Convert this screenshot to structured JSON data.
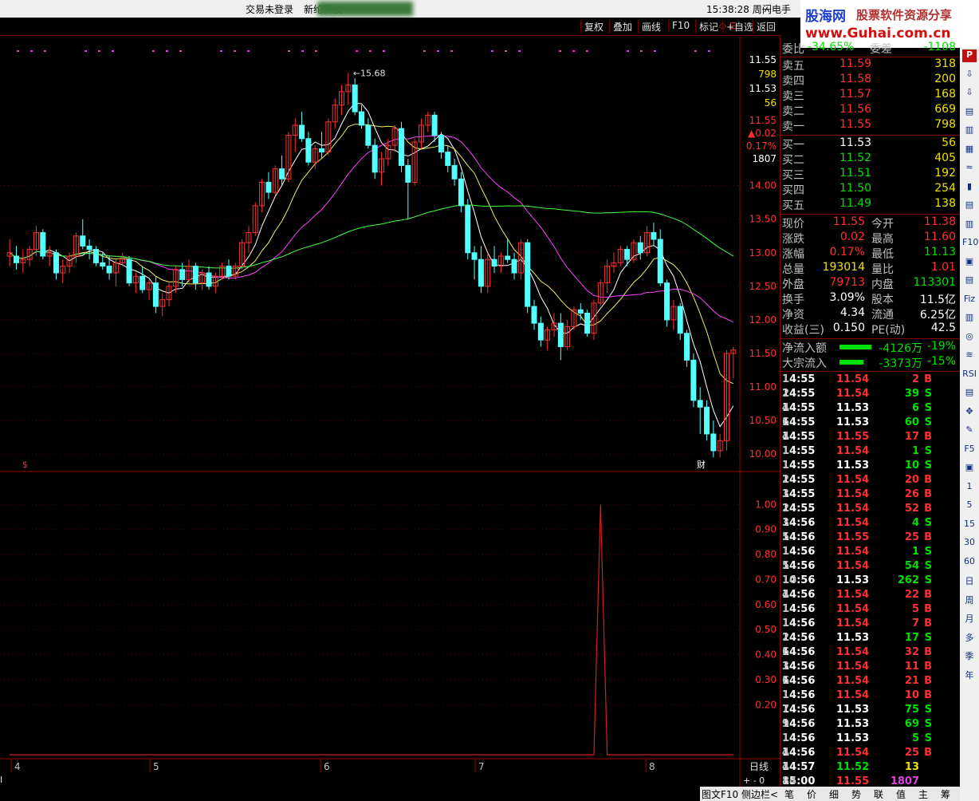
{
  "titlebar": {
    "login_status": "交易未登录",
    "stock_name": "新纶科技",
    "clock": "15:38:28 周一",
    "flash": "闪电手"
  },
  "logo": {
    "brand": "股海网",
    "slogan": "股票软件资源分享",
    "url": "www.Guhai.com.cn"
  },
  "toolbar": {
    "buttons": [
      "复权",
      "叠加",
      "画线",
      "F10",
      "标记",
      "+自选",
      "返回"
    ],
    "corner_icons": "◇ ⊟"
  },
  "price_axis": {
    "labels": [
      "14.00",
      "13.50",
      "13.00",
      "12.50",
      "12.00",
      "11.50",
      "11.00",
      "10.50",
      "10.00"
    ],
    "readout": {
      "price1": "11.55",
      "vol1": "798",
      "price2": "11.53",
      "vol2": "56",
      "price3": "11.55",
      "chg": "▲0.02",
      "pct": "0.17%",
      "vol3": "1807"
    }
  },
  "peak_label": "15.68",
  "chart_markers": {
    "s_marker": "$",
    "cai_marker": "财"
  },
  "indicator_axis": {
    "labels": [
      "1.00",
      "0.90",
      "0.80",
      "0.70",
      "0.60",
      "0.50",
      "0.40",
      "0.30",
      "0.20"
    ]
  },
  "x_axis": {
    "labels": [
      "4",
      "5",
      "6",
      "7",
      "8"
    ],
    "period": "日线",
    "left_glyph": "I",
    "zoom": "+ - 0"
  },
  "chart_data": {
    "type": "candlestick",
    "candles": [
      [
        12.95,
        13.2,
        12.8,
        13.0
      ],
      [
        12.95,
        13.1,
        12.75,
        12.85
      ],
      [
        12.85,
        13.05,
        12.7,
        12.9
      ],
      [
        12.9,
        13.1,
        12.8,
        13.05
      ],
      [
        13.05,
        13.4,
        12.95,
        13.3
      ],
      [
        13.3,
        13.35,
        12.9,
        12.95
      ],
      [
        12.95,
        13.1,
        12.8,
        13.0
      ],
      [
        13.0,
        13.05,
        12.6,
        12.7
      ],
      [
        12.7,
        12.9,
        12.55,
        12.8
      ],
      [
        12.8,
        13.0,
        12.7,
        12.95
      ],
      [
        12.95,
        13.3,
        12.85,
        13.25
      ],
      [
        13.25,
        13.5,
        13.05,
        13.1
      ],
      [
        13.1,
        13.2,
        12.9,
        13.05
      ],
      [
        13.05,
        13.1,
        12.8,
        12.85
      ],
      [
        12.85,
        13.0,
        12.75,
        12.8
      ],
      [
        12.8,
        12.95,
        12.6,
        12.7
      ],
      [
        12.7,
        12.9,
        12.5,
        12.85
      ],
      [
        12.85,
        13.0,
        12.8,
        12.9
      ],
      [
        12.9,
        12.95,
        12.5,
        12.55
      ],
      [
        12.55,
        12.7,
        12.4,
        12.65
      ],
      [
        12.65,
        12.8,
        12.4,
        12.45
      ],
      [
        12.45,
        12.6,
        12.3,
        12.55
      ],
      [
        12.55,
        12.65,
        12.1,
        12.2
      ],
      [
        12.2,
        12.4,
        12.05,
        12.3
      ],
      [
        12.3,
        12.55,
        12.2,
        12.5
      ],
      [
        12.5,
        12.8,
        12.4,
        12.75
      ],
      [
        12.75,
        12.85,
        12.5,
        12.6
      ],
      [
        12.6,
        12.9,
        12.55,
        12.8
      ],
      [
        12.8,
        12.85,
        12.45,
        12.55
      ],
      [
        12.55,
        12.75,
        12.45,
        12.7
      ],
      [
        12.7,
        12.8,
        12.45,
        12.5
      ],
      [
        12.5,
        12.7,
        12.4,
        12.65
      ],
      [
        12.65,
        12.85,
        12.6,
        12.8
      ],
      [
        12.8,
        12.9,
        12.6,
        12.65
      ],
      [
        12.65,
        12.85,
        12.6,
        12.8
      ],
      [
        12.8,
        13.2,
        12.75,
        13.15
      ],
      [
        13.15,
        13.4,
        13.0,
        13.3
      ],
      [
        13.3,
        13.75,
        13.25,
        13.7
      ],
      [
        13.7,
        14.1,
        13.6,
        14.05
      ],
      [
        14.05,
        14.2,
        13.8,
        13.9
      ],
      [
        13.9,
        14.3,
        13.85,
        14.25
      ],
      [
        14.25,
        14.45,
        14.0,
        14.1
      ],
      [
        14.1,
        14.8,
        14.05,
        14.75
      ],
      [
        14.75,
        15.0,
        14.5,
        14.9
      ],
      [
        14.9,
        15.1,
        14.65,
        14.7
      ],
      [
        14.7,
        14.8,
        14.3,
        14.35
      ],
      [
        14.35,
        14.6,
        14.25,
        14.55
      ],
      [
        14.55,
        14.8,
        14.4,
        14.5
      ],
      [
        14.5,
        15.0,
        14.45,
        14.95
      ],
      [
        14.95,
        15.3,
        14.85,
        15.2
      ],
      [
        15.2,
        15.5,
        15.05,
        15.4
      ],
      [
        15.4,
        15.68,
        15.2,
        15.5
      ],
      [
        15.5,
        15.6,
        15.05,
        15.1
      ],
      [
        15.1,
        15.2,
        14.85,
        14.9
      ],
      [
        14.9,
        15.0,
        14.55,
        14.6
      ],
      [
        14.6,
        14.7,
        14.1,
        14.2
      ],
      [
        14.2,
        14.5,
        14.0,
        14.4
      ],
      [
        14.4,
        14.7,
        14.3,
        14.6
      ],
      [
        14.6,
        14.9,
        14.5,
        14.85
      ],
      [
        14.85,
        14.95,
        14.2,
        14.3
      ],
      [
        14.3,
        14.4,
        13.5,
        14.05
      ],
      [
        14.05,
        14.7,
        14.0,
        14.65
      ],
      [
        14.65,
        15.0,
        14.55,
        14.9
      ],
      [
        14.9,
        15.1,
        14.8,
        15.05
      ],
      [
        15.05,
        15.1,
        14.65,
        14.75
      ],
      [
        14.75,
        14.8,
        14.4,
        14.5
      ],
      [
        14.5,
        14.6,
        14.2,
        14.3
      ],
      [
        14.3,
        14.4,
        14.0,
        14.1
      ],
      [
        14.1,
        14.2,
        13.6,
        13.7
      ],
      [
        13.7,
        13.8,
        12.9,
        13.0
      ],
      [
        13.0,
        13.1,
        12.6,
        12.9
      ],
      [
        12.9,
        13.1,
        12.4,
        12.5
      ],
      [
        12.5,
        13.0,
        12.4,
        12.9
      ],
      [
        12.9,
        13.1,
        12.7,
        12.8
      ],
      [
        12.8,
        13.0,
        12.7,
        12.95
      ],
      [
        12.95,
        13.2,
        12.85,
        12.9
      ],
      [
        12.9,
        13.0,
        12.6,
        12.7
      ],
      [
        12.7,
        13.2,
        12.6,
        13.15
      ],
      [
        13.15,
        13.2,
        12.1,
        12.2
      ],
      [
        12.2,
        12.3,
        11.85,
        11.95
      ],
      [
        11.95,
        12.05,
        11.6,
        11.7
      ],
      [
        11.7,
        11.9,
        11.55,
        11.85
      ],
      [
        11.85,
        12.1,
        11.75,
        11.95
      ],
      [
        11.95,
        12.1,
        11.4,
        11.6
      ],
      [
        11.6,
        12.0,
        11.55,
        11.9
      ],
      [
        11.9,
        12.2,
        11.85,
        12.15
      ],
      [
        12.15,
        12.25,
        12.0,
        12.1
      ],
      [
        12.1,
        12.15,
        11.75,
        11.8
      ],
      [
        11.8,
        12.3,
        11.7,
        12.25
      ],
      [
        12.25,
        12.6,
        12.2,
        12.55
      ],
      [
        12.55,
        12.9,
        12.4,
        12.8
      ],
      [
        12.8,
        13.0,
        12.7,
        12.85
      ],
      [
        12.85,
        13.1,
        12.8,
        13.05
      ],
      [
        13.05,
        13.1,
        12.8,
        12.9
      ],
      [
        12.9,
        13.2,
        12.85,
        13.15
      ],
      [
        13.15,
        13.25,
        12.9,
        13.0
      ],
      [
        13.0,
        13.4,
        12.95,
        13.3
      ],
      [
        13.3,
        13.45,
        13.1,
        13.2
      ],
      [
        13.2,
        13.35,
        12.5,
        12.55
      ],
      [
        12.55,
        12.6,
        11.9,
        12.0
      ],
      [
        12.0,
        12.3,
        11.85,
        12.2
      ],
      [
        12.2,
        12.25,
        11.7,
        11.8
      ],
      [
        11.8,
        11.85,
        11.3,
        11.4
      ],
      [
        11.4,
        11.5,
        10.7,
        10.8
      ],
      [
        10.8,
        11.0,
        10.3,
        10.7
      ],
      [
        10.7,
        10.8,
        10.2,
        10.3
      ],
      [
        10.3,
        10.5,
        9.95,
        10.05
      ],
      [
        10.05,
        10.3,
        9.95,
        10.2
      ],
      [
        10.2,
        11.55,
        10.05,
        11.5
      ],
      [
        11.5,
        11.6,
        11.13,
        11.55
      ]
    ],
    "ylim": [
      9.8,
      16.1
    ],
    "indicator": {
      "ylim": [
        0,
        1.1
      ],
      "spikes_at": [
        89,
        115
      ]
    }
  },
  "quote": {
    "weibi": {
      "label": "委比",
      "value": "-34.65%",
      "label2": "委差",
      "value2": "-1108"
    },
    "sells": [
      {
        "label": "卖五",
        "price": "11.59",
        "vol": "318"
      },
      {
        "label": "卖四",
        "price": "11.58",
        "vol": "200"
      },
      {
        "label": "卖三",
        "price": "11.57",
        "vol": "168"
      },
      {
        "label": "卖二",
        "price": "11.56",
        "vol": "669"
      },
      {
        "label": "卖一",
        "price": "11.55",
        "vol": "798"
      }
    ],
    "buys": [
      {
        "label": "买一",
        "price": "11.53",
        "vol": "56"
      },
      {
        "label": "买二",
        "price": "11.52",
        "vol": "405"
      },
      {
        "label": "买三",
        "price": "11.51",
        "vol": "192"
      },
      {
        "label": "买四",
        "price": "11.50",
        "vol": "254"
      },
      {
        "label": "买五",
        "price": "11.49",
        "vol": "138"
      }
    ],
    "stats": [
      {
        "l1": "现价",
        "v1": "11.55",
        "l2": "今开",
        "v2": "11.38",
        "c1": "red",
        "c2": "red"
      },
      {
        "l1": "涨跌",
        "v1": "0.02",
        "l2": "最高",
        "v2": "11.60",
        "c1": "red",
        "c2": "red"
      },
      {
        "l1": "涨幅",
        "v1": "0.17%",
        "l2": "最低",
        "v2": "11.13",
        "c1": "red",
        "c2": "grn"
      },
      {
        "l1": "总量",
        "v1": "193014",
        "l2": "量比",
        "v2": "1.01",
        "c1": "yel",
        "c2": "red"
      },
      {
        "l1": "外盘",
        "v1": "79713",
        "l2": "内盘",
        "v2": "113301",
        "c1": "red",
        "c2": "grn"
      },
      {
        "l1": "换手",
        "v1": "3.09%",
        "l2": "股本",
        "v2": "11.5亿",
        "c1": "wht",
        "c2": "wht"
      },
      {
        "l1": "净资",
        "v1": "4.34",
        "l2": "流通",
        "v2": "6.25亿",
        "c1": "wht",
        "c2": "wht"
      },
      {
        "l1": "收益(三)",
        "v1": "0.150",
        "l2": "PE(动)",
        "v2": "42.5",
        "c1": "wht",
        "c2": "wht"
      }
    ],
    "flows": [
      {
        "label": "净流入额",
        "value": "-4126万",
        "pct": "-19%",
        "bar": 0.8
      },
      {
        "label": "大宗流入",
        "value": "-3373万",
        "pct": "-15%",
        "bar": 0.6
      }
    ]
  },
  "ticks": [
    [
      "14:55",
      "11.54",
      "2",
      "B",
      "1"
    ],
    [
      "14:55",
      "11.54",
      "39",
      "S",
      "2"
    ],
    [
      "14:55",
      "11.53",
      "6",
      "S",
      "4"
    ],
    [
      "14:55",
      "11.53",
      "60",
      "S",
      "6"
    ],
    [
      "14:55",
      "11.55",
      "17",
      "B",
      "4"
    ],
    [
      "14:55",
      "11.54",
      "1",
      "S",
      "1"
    ],
    [
      "14:55",
      "11.53",
      "10",
      "S",
      "1"
    ],
    [
      "14:55",
      "11.54",
      "20",
      "B",
      "2"
    ],
    [
      "14:55",
      "11.54",
      "26",
      "B",
      "3"
    ],
    [
      "14:55",
      "11.54",
      "52",
      "B",
      "2"
    ],
    [
      "14:56",
      "11.54",
      "4",
      "S",
      "3"
    ],
    [
      "14:56",
      "11.55",
      "25",
      "B",
      "5"
    ],
    [
      "14:56",
      "11.54",
      "1",
      "S",
      "1"
    ],
    [
      "14:56",
      "11.54",
      "54",
      "S",
      "5"
    ],
    [
      "14:56",
      "11.53",
      "262",
      "S",
      "10"
    ],
    [
      "14:56",
      "11.54",
      "22",
      "B",
      "4"
    ],
    [
      "14:56",
      "11.54",
      "5",
      "B",
      "1"
    ],
    [
      "14:56",
      "11.54",
      "7",
      "B",
      "1"
    ],
    [
      "14:56",
      "11.53",
      "17",
      "S",
      "2"
    ],
    [
      "14:56",
      "11.54",
      "32",
      "B",
      "6"
    ],
    [
      "14:56",
      "11.54",
      "11",
      "B",
      "3"
    ],
    [
      "14:56",
      "11.54",
      "21",
      "B",
      "6"
    ],
    [
      "14:56",
      "11.54",
      "10",
      "B",
      "1"
    ],
    [
      "14:56",
      "11.53",
      "75",
      "S",
      "7"
    ],
    [
      "14:56",
      "11.53",
      "69",
      "S",
      "9"
    ],
    [
      "14:56",
      "11.53",
      "5",
      "S",
      "1"
    ],
    [
      "14:56",
      "11.54",
      "25",
      "B",
      "4"
    ],
    [
      "14:57",
      "11.52",
      "13",
      "",
      "4"
    ],
    [
      "15:00",
      "11.55",
      "1807",
      "",
      "84"
    ]
  ],
  "side_icons": [
    "P",
    "⇩",
    "⇩",
    "▤",
    "▥",
    "▦",
    "≈",
    "▮",
    "▤",
    "▥",
    "F10",
    "▣",
    "▤",
    "Fiz",
    "▥",
    "◎",
    "≋",
    "RSI",
    "▤",
    "✥",
    "✎",
    "F5",
    "▣",
    "1",
    "5",
    "15",
    "30",
    "60",
    "日",
    "周",
    "月",
    "多",
    "季",
    "年"
  ],
  "bottom_tabs": {
    "left": "图文F10",
    "left2": "侧边栏<",
    "tabs": [
      "笔",
      "价",
      "细",
      "势",
      "联",
      "值",
      "主",
      "筹"
    ]
  }
}
